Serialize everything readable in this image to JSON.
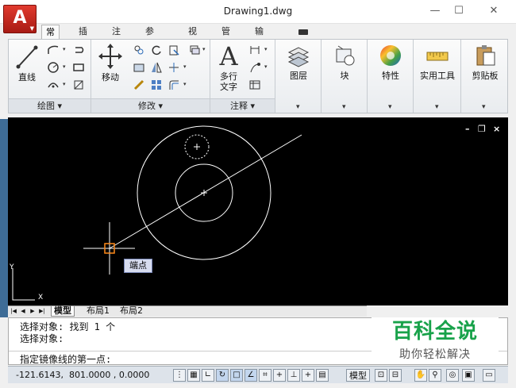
{
  "window": {
    "title": "Drawing1.dwg",
    "app_button": "A"
  },
  "ribbon_tabs": [
    "常用",
    "插入",
    "注释",
    "参数化",
    "视图",
    "管理",
    "输出"
  ],
  "ribbon": {
    "draw_panel": {
      "title": "绘图 ▾",
      "line": "直线"
    },
    "modify_panel": {
      "title": "修改 ▾",
      "move": "移动"
    },
    "annotation_panel": {
      "title": "注释 ▾",
      "mtext_1": "多行",
      "mtext_2": "文字"
    },
    "layers": "图层",
    "block": "块",
    "properties": "特性",
    "utilities": "实用工具",
    "clipboard": "剪贴板",
    "mtext_icon": "A"
  },
  "canvas": {
    "snap_tooltip": "端点",
    "axis_x": "X",
    "axis_y": "Y",
    "close_glyph": "×",
    "restore_glyph": "❐",
    "min_glyph": "–"
  },
  "layout_tabs": [
    "模型",
    "布局1",
    "布局2"
  ],
  "command": {
    "lines": [
      "选择对象: 找到 1 个",
      "选择对象:"
    ],
    "prompt": "指定镜像线的第一点:"
  },
  "watermark": {
    "title": "百科全说",
    "subtitle": "助你轻松解决"
  },
  "status": {
    "coordinates": "-121.6143,  801.0000 , 0.0000",
    "model": "模型"
  }
}
